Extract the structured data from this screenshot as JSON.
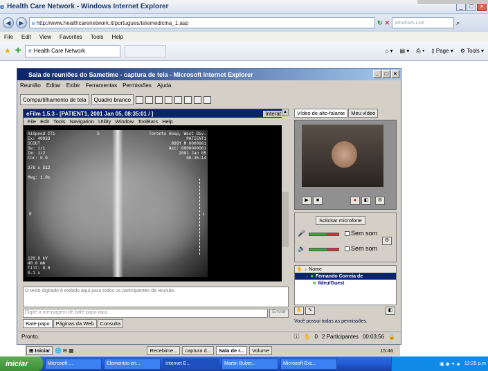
{
  "browser": {
    "title": "Health Care Network - Windows Internet Explorer",
    "url": "http://www.healthcarenetwork.it/portugues/telemedicina_1.asp",
    "search_placeholder": "Windows Live",
    "menu": [
      "File",
      "Edit",
      "View",
      "Favorites",
      "Tools",
      "Help"
    ],
    "tab_label": "Health Care Network",
    "tools": [
      "Page",
      "Tools"
    ]
  },
  "meeting": {
    "title": "Sala de reuniões do Sametime - captura de tela - Microsoft Internet Explorer",
    "menu": [
      "Reunião",
      "Editar",
      "Exibir",
      "Ferramentas",
      "Permissões",
      "Ajuda"
    ],
    "toolbar": {
      "share_label": "Compartilhamento de tela",
      "whiteboard_label": "Quadro branco"
    },
    "efilm": {
      "title": "eFilm 1.5.3 - [PATIENT1, 2001 Jan 05, 08:35:01 / ]",
      "interact": "Interat",
      "menu": [
        "File",
        "Edit",
        "Tools",
        "Navigation",
        "Utility",
        "Window",
        "ToolBars",
        "Help"
      ],
      "overlay_tl": [
        "HiSpeed CTi",
        "Ex: 40933",
        "SCOUT",
        "Se: 1/1",
        "Im: 1/2",
        "Cor: 0.0",
        "",
        "376 x 512",
        "",
        "Mag: 1.0x"
      ],
      "overlay_tr": [
        "Toronto Hosp, West Div.",
        "PATIENT1",
        "099Y M 0000001",
        "Acc: 0000000001",
        "2001 Jan 05",
        "08:35:14"
      ],
      "overlay_bl": [
        "120.0 kV",
        "40.0 mA",
        "Tilt: 0.0",
        "0.1 s"
      ],
      "marker_r": "R",
      "marker_l": "L",
      "marker_s": "S"
    },
    "chat_text": "O texto digitado é exibido aqui para todos os participantes da reunião.",
    "chat_placeholder": "Digite a mensagem de bate-papo aqui...",
    "send_label": "Enviar",
    "tabs": [
      "Bate-papo",
      "Páginas da Web",
      "Consulta"
    ],
    "status": "Pronto.",
    "video_tabs": [
      "Vídeo de alto-falante",
      "Meu vídeo"
    ],
    "mic_button": "Solicitar microfone",
    "no_sound_1": "Sem som",
    "no_sound_2": "Sem som",
    "name_header": "Nome",
    "participants": [
      "Fernando Correia de",
      "Ildeu/Guest"
    ],
    "permissions_text": "Você possui todas as permissões.",
    "participant_count": "2 Participantes",
    "count_prefix": "0",
    "elapsed": "00:03:56"
  },
  "classic_taskbar": {
    "start_label": "Iniciar",
    "items": [
      "Recebime...",
      "captura d...",
      "Sala de r...",
      "Volume"
    ],
    "clock": "15:46"
  },
  "xp_taskbar": {
    "start_label": "iniciar",
    "items": [
      "Microsoft ...",
      "Elementos en...",
      "Internet E...",
      "Martin Buber...",
      "Microsoft Exc..."
    ],
    "clock": "12:29 p.m"
  }
}
